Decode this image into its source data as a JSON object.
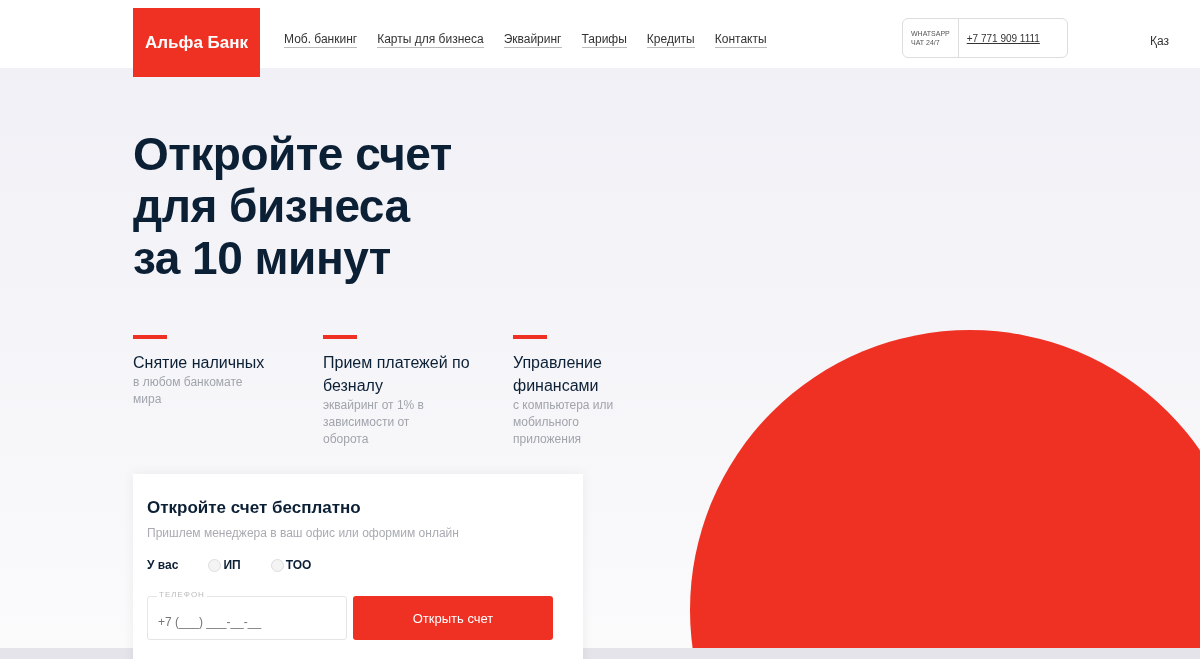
{
  "logo": "Альфа Банк",
  "nav": [
    "Моб. банкинг",
    "Карты для бизнеса",
    "Эквайринг",
    "Тарифы",
    "Кредиты",
    "Контакты"
  ],
  "contact": {
    "label_lines": [
      "WHATSAPP",
      "ЧАТ 24/7"
    ],
    "phone": "+7 771 909 1111"
  },
  "language": "Қаз",
  "hero": {
    "title_lines": [
      "Откройте счет",
      "для бизнеса",
      "за 10 минут"
    ]
  },
  "features": [
    {
      "title": "Снятие наличных",
      "text": "в любом банкомате мира"
    },
    {
      "title": "Прием платежей по безналу",
      "text": "эквайринг от 1% в зависимости от оборота"
    },
    {
      "title": "Управление финансами",
      "text": "с компьютера или мобильного приложения"
    }
  ],
  "form": {
    "title": "Откройте счет бесплатно",
    "subtitle": "Пришлем менеджера в ваш офис или оформим онлайн",
    "radio_label": "У вас",
    "options": [
      {
        "label": "ИП",
        "selected": false
      },
      {
        "label": "ТОО",
        "selected": false
      }
    ],
    "phone_label": "ТЕЛЕФОН",
    "phone_placeholder": "+7 (___) ___-__-__",
    "submit": "Открыть счет"
  }
}
